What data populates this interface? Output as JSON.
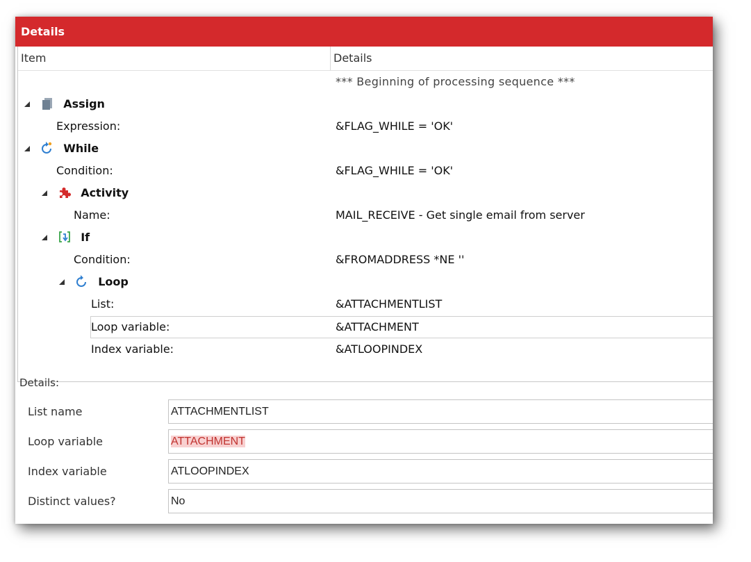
{
  "window": {
    "title": "Details"
  },
  "grid": {
    "headers": {
      "item": "Item",
      "details": "Details"
    },
    "sequence_note": "*** Beginning of processing sequence ***",
    "rows": [
      {
        "label": "Assign",
        "icon": "assign-icon"
      },
      {
        "label": "Expression:",
        "value": "&FLAG_WHILE = 'OK'"
      },
      {
        "label": "While",
        "icon": "while-loop-icon"
      },
      {
        "label": "Condition:",
        "value": "&FLAG_WHILE = 'OK'"
      },
      {
        "label": "Activity",
        "icon": "activity-puzzle-icon"
      },
      {
        "label": "Name:",
        "value": "MAIL_RECEIVE - Get single email from server"
      },
      {
        "label": "If",
        "icon": "if-branch-icon"
      },
      {
        "label": "Condition:",
        "value": "&FROMADDRESS *NE ''"
      },
      {
        "label": "Loop",
        "icon": "loop-icon"
      },
      {
        "label": "List:",
        "value": "&ATTACHMENTLIST"
      },
      {
        "label": "Loop variable:",
        "value": "&ATTACHMENT"
      },
      {
        "label": "Index variable:",
        "value": "&ATLOOPINDEX"
      }
    ]
  },
  "details_panel": {
    "heading": "Details:",
    "fields": [
      {
        "label": "List name",
        "value": "ATTACHMENTLIST"
      },
      {
        "label": "Loop variable",
        "value": "ATTACHMENT"
      },
      {
        "label": "Index variable",
        "value": "ATLOOPINDEX"
      },
      {
        "label": "Distinct values?",
        "value": "No"
      }
    ]
  },
  "colors": {
    "title_bar": "#d4292c",
    "error_text": "#c0322f",
    "error_highlight": "#f8d0d0"
  }
}
